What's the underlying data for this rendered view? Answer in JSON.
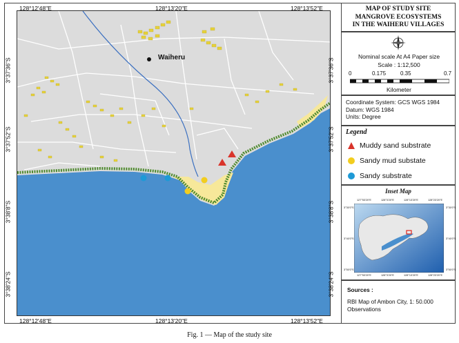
{
  "map": {
    "place_label": "Waiheru",
    "top_ticks": [
      "128°12'48\"E",
      "128°13'20\"E",
      "128°13'52\"E"
    ],
    "bottom_ticks": [
      "128°12'48\"E",
      "128°13'20\"E",
      "128°13'52\"E"
    ],
    "left_ticks": [
      "3°37'36\"S",
      "3°37'52\"S",
      "3°38'8\"S",
      "3°38'24\"S"
    ],
    "right_ticks": [
      "3°37'36\"S",
      "3°37'52\"S",
      "3°38'8\"S",
      "3°38'24\"S"
    ],
    "colors": {
      "land": "#dcdcdc",
      "sea": "#4a8fcd",
      "beach": "#f7e89a",
      "mangrove": "#4f8a2e",
      "buildings": "#e6d23c",
      "roads": "#ffffff",
      "river": "#3a6fc0"
    }
  },
  "sample_points": {
    "muddy_sand": {
      "color": "#d9342b",
      "shape": "triangle",
      "count": 2
    },
    "sandy_mud": {
      "color": "#f2cd1f",
      "shape": "circle",
      "count": 2
    },
    "sandy": {
      "color": "#1e9ad6",
      "shape": "circle",
      "count": 2
    }
  },
  "title": {
    "line1": "MAP OF STUDY SITE",
    "line2": "MANGROVE ECOSYSTEMS",
    "line3": "IN THE WAIHERU VILLAGES"
  },
  "scale": {
    "nominal": "Nominal scale  At A4 Paper size",
    "scale_text": "Scale : 1:12,500",
    "ticks": [
      "0",
      "0.175",
      "0.35",
      "0.7"
    ],
    "unit": "Kilometer",
    "north_icon": "compass-rose"
  },
  "coordinate_system": {
    "line1": "Coordinate System: GCS WGS 1984",
    "line2": "Datum: WGS 1984",
    "line3": "Units: Degree"
  },
  "legend": {
    "title": "Legend",
    "items": [
      {
        "label": "Muddy sand substrate",
        "color": "#d9342b",
        "shape": "triangle"
      },
      {
        "label": "Sandy mud substate",
        "color": "#f2cd1f",
        "shape": "circle"
      },
      {
        "label": "Sandy substrate",
        "color": "#1e9ad6",
        "shape": "circle"
      }
    ]
  },
  "inset": {
    "title": "Inset Map",
    "top_ticks": [
      "127°53'20\"E",
      "128°3'20\"E",
      "128°13'20\"E",
      "128°23'20\"E"
    ],
    "bottom_ticks": [
      "127°53'20\"E",
      "128°3'20\"E",
      "128°13'20\"E",
      "128°23'20\"E"
    ],
    "left_ticks": [
      "3°30'0\"S",
      "3°40'0\"S",
      "3°50'0\"S"
    ],
    "right_ticks": [
      "3°30'0\"S",
      "3°40'0\"S",
      "3°50'0\"S"
    ],
    "highlight_color": "#e0261e"
  },
  "sources": {
    "heading": "Sources :",
    "text": "RBI Map of Ambon City, 1: 50.000 Observations"
  },
  "caption": "Fig. 1 — Map of the study site"
}
